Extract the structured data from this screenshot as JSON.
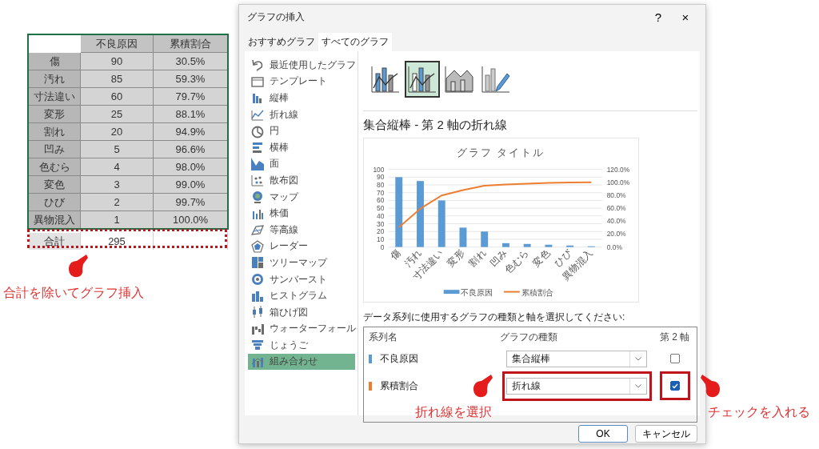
{
  "sheet": {
    "columns": [
      "不良原因",
      "累積割合"
    ],
    "rows": [
      {
        "label": "傷",
        "count": "90",
        "ratio": "30.5%"
      },
      {
        "label": "汚れ",
        "count": "85",
        "ratio": "59.3%"
      },
      {
        "label": "寸法違い",
        "count": "60",
        "ratio": "79.7%"
      },
      {
        "label": "変形",
        "count": "25",
        "ratio": "88.1%"
      },
      {
        "label": "割れ",
        "count": "20",
        "ratio": "94.9%"
      },
      {
        "label": "凹み",
        "count": "5",
        "ratio": "96.6%"
      },
      {
        "label": "色むら",
        "count": "4",
        "ratio": "98.0%"
      },
      {
        "label": "変色",
        "count": "3",
        "ratio": "99.0%"
      },
      {
        "label": "ひび",
        "count": "2",
        "ratio": "99.7%"
      },
      {
        "label": "異物混入",
        "count": "1",
        "ratio": "100.0%"
      }
    ],
    "total": {
      "label": "合計",
      "count": "295"
    }
  },
  "dialog": {
    "title": "グラフの挿入",
    "help": "?",
    "close": "×",
    "tabs": [
      {
        "label": "おすすめグラフ",
        "selected": false
      },
      {
        "label": "すべてのグラフ",
        "selected": true
      }
    ],
    "chart_types": [
      {
        "label": "最近使用したグラフ",
        "selected": false
      },
      {
        "label": "テンプレート",
        "selected": false
      },
      {
        "label": "縦棒",
        "selected": false
      },
      {
        "label": "折れ線",
        "selected": false
      },
      {
        "label": "円",
        "selected": false
      },
      {
        "label": "横棒",
        "selected": false
      },
      {
        "label": "面",
        "selected": false
      },
      {
        "label": "散布図",
        "selected": false
      },
      {
        "label": "マップ",
        "selected": false
      },
      {
        "label": "株価",
        "selected": false
      },
      {
        "label": "等高線",
        "selected": false
      },
      {
        "label": "レーダー",
        "selected": false
      },
      {
        "label": "ツリーマップ",
        "selected": false
      },
      {
        "label": "サンバースト",
        "selected": false
      },
      {
        "label": "ヒストグラム",
        "selected": false
      },
      {
        "label": "箱ひげ図",
        "selected": false
      },
      {
        "label": "ウォーターフォール",
        "selected": false
      },
      {
        "label": "じょうご",
        "selected": false
      },
      {
        "label": "組み合わせ",
        "selected": true
      }
    ],
    "subtypes": [
      {
        "selected": false
      },
      {
        "selected": true
      },
      {
        "selected": false
      },
      {
        "selected": false
      }
    ],
    "subtype_title": "集合縦棒 - 第 2 軸の折れ線",
    "preview": {
      "chart_data": {
        "type": "bar",
        "title": "グラフ タイトル",
        "categories": [
          "傷",
          "汚れ",
          "寸法違い",
          "変形",
          "割れ",
          "凹み",
          "色むら",
          "変色",
          "ひび",
          "異物混入"
        ],
        "series": [
          {
            "name": "不良原因",
            "type": "bar",
            "color": "#5b9bd5",
            "values": [
              90,
              85,
              60,
              25,
              20,
              5,
              4,
              3,
              2,
              1
            ]
          },
          {
            "name": "累積割合",
            "type": "line",
            "axis": "y2",
            "color": "#ed7d31",
            "values": [
              30.5,
              59.3,
              79.7,
              88.1,
              94.9,
              96.6,
              98.0,
              99.0,
              99.7,
              100.0
            ]
          }
        ],
        "stacked": false,
        "grid": true,
        "legend": true,
        "ylim": [
          0,
          100
        ],
        "yticks": [
          0,
          10,
          20,
          30,
          40,
          50,
          60,
          70,
          80,
          90,
          100
        ],
        "y2lim": [
          0,
          120
        ],
        "y2ticks": [
          {
            "value": 0,
            "label": "0.0%"
          },
          {
            "value": 20,
            "label": "20.0%"
          },
          {
            "value": 40,
            "label": "40.0%"
          },
          {
            "value": 60,
            "label": "60.0%"
          },
          {
            "value": 80,
            "label": "80.0%"
          },
          {
            "value": 100,
            "label": "100.0%"
          },
          {
            "value": 120,
            "label": "120.0%"
          }
        ]
      }
    },
    "series_prompt": "データ系列に使用するグラフの種類と軸を選択してください:",
    "series_columns": [
      "系列名",
      "グラフの種類",
      "第 2 軸"
    ],
    "series_rows": [
      {
        "name": "不良原因",
        "color": "#5b9bd5",
        "chart_type": "集合縦棒",
        "secondary": false
      },
      {
        "name": "累積割合",
        "color": "#ed7d31",
        "chart_type": "折れ線",
        "secondary": true
      }
    ],
    "buttons": [
      "OK",
      "キャンセル"
    ]
  },
  "annotations": [
    {
      "text": "合計を除いてグラフ挿入"
    },
    {
      "text": "折れ線を選択"
    },
    {
      "text": "チェックを入れる"
    }
  ]
}
